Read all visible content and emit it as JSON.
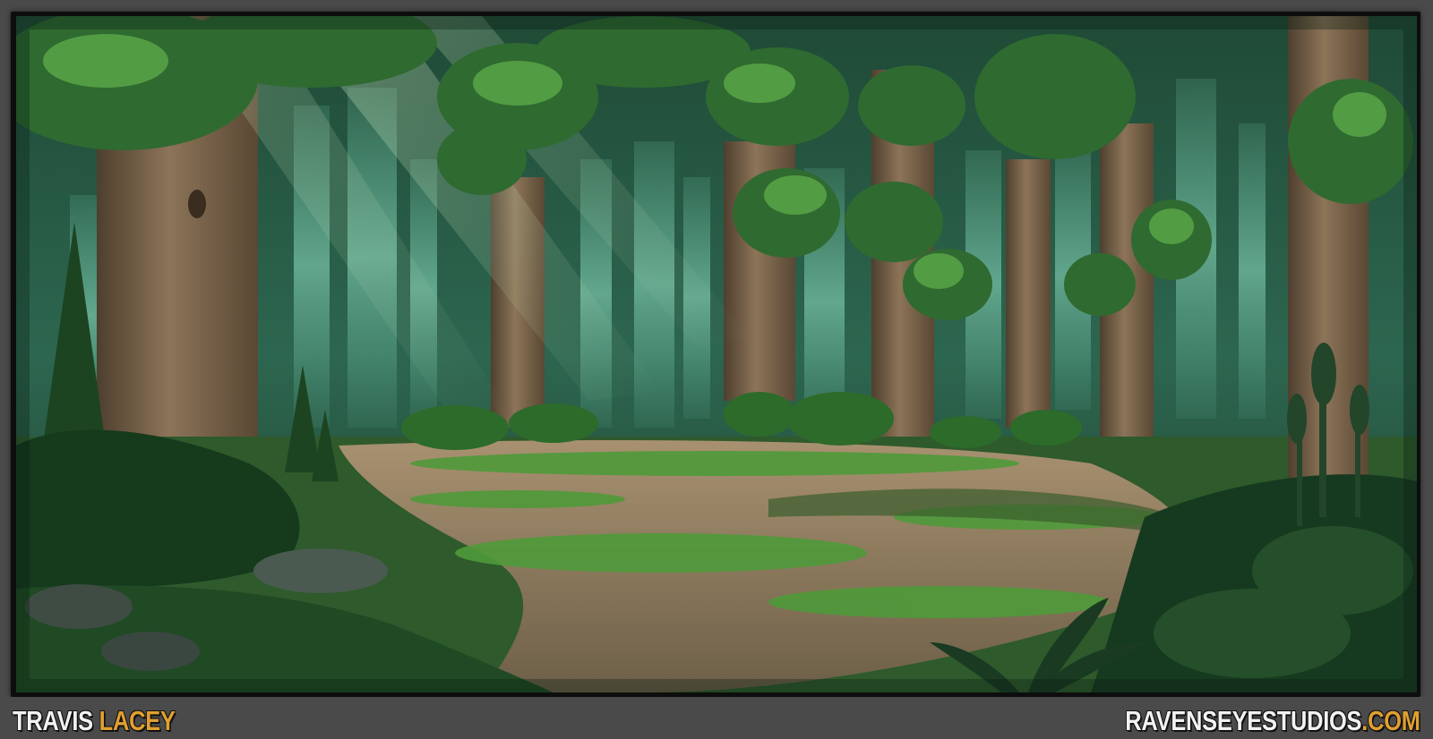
{
  "artist": {
    "first": "TRAVIS",
    "last": "LACEY"
  },
  "website": {
    "name": "RAVENSEYESTUDIOS",
    "tld": ".COM"
  },
  "colors": {
    "accent": "#e0a030",
    "text": "#f2f2f2",
    "bar": "#4a4a4a"
  }
}
